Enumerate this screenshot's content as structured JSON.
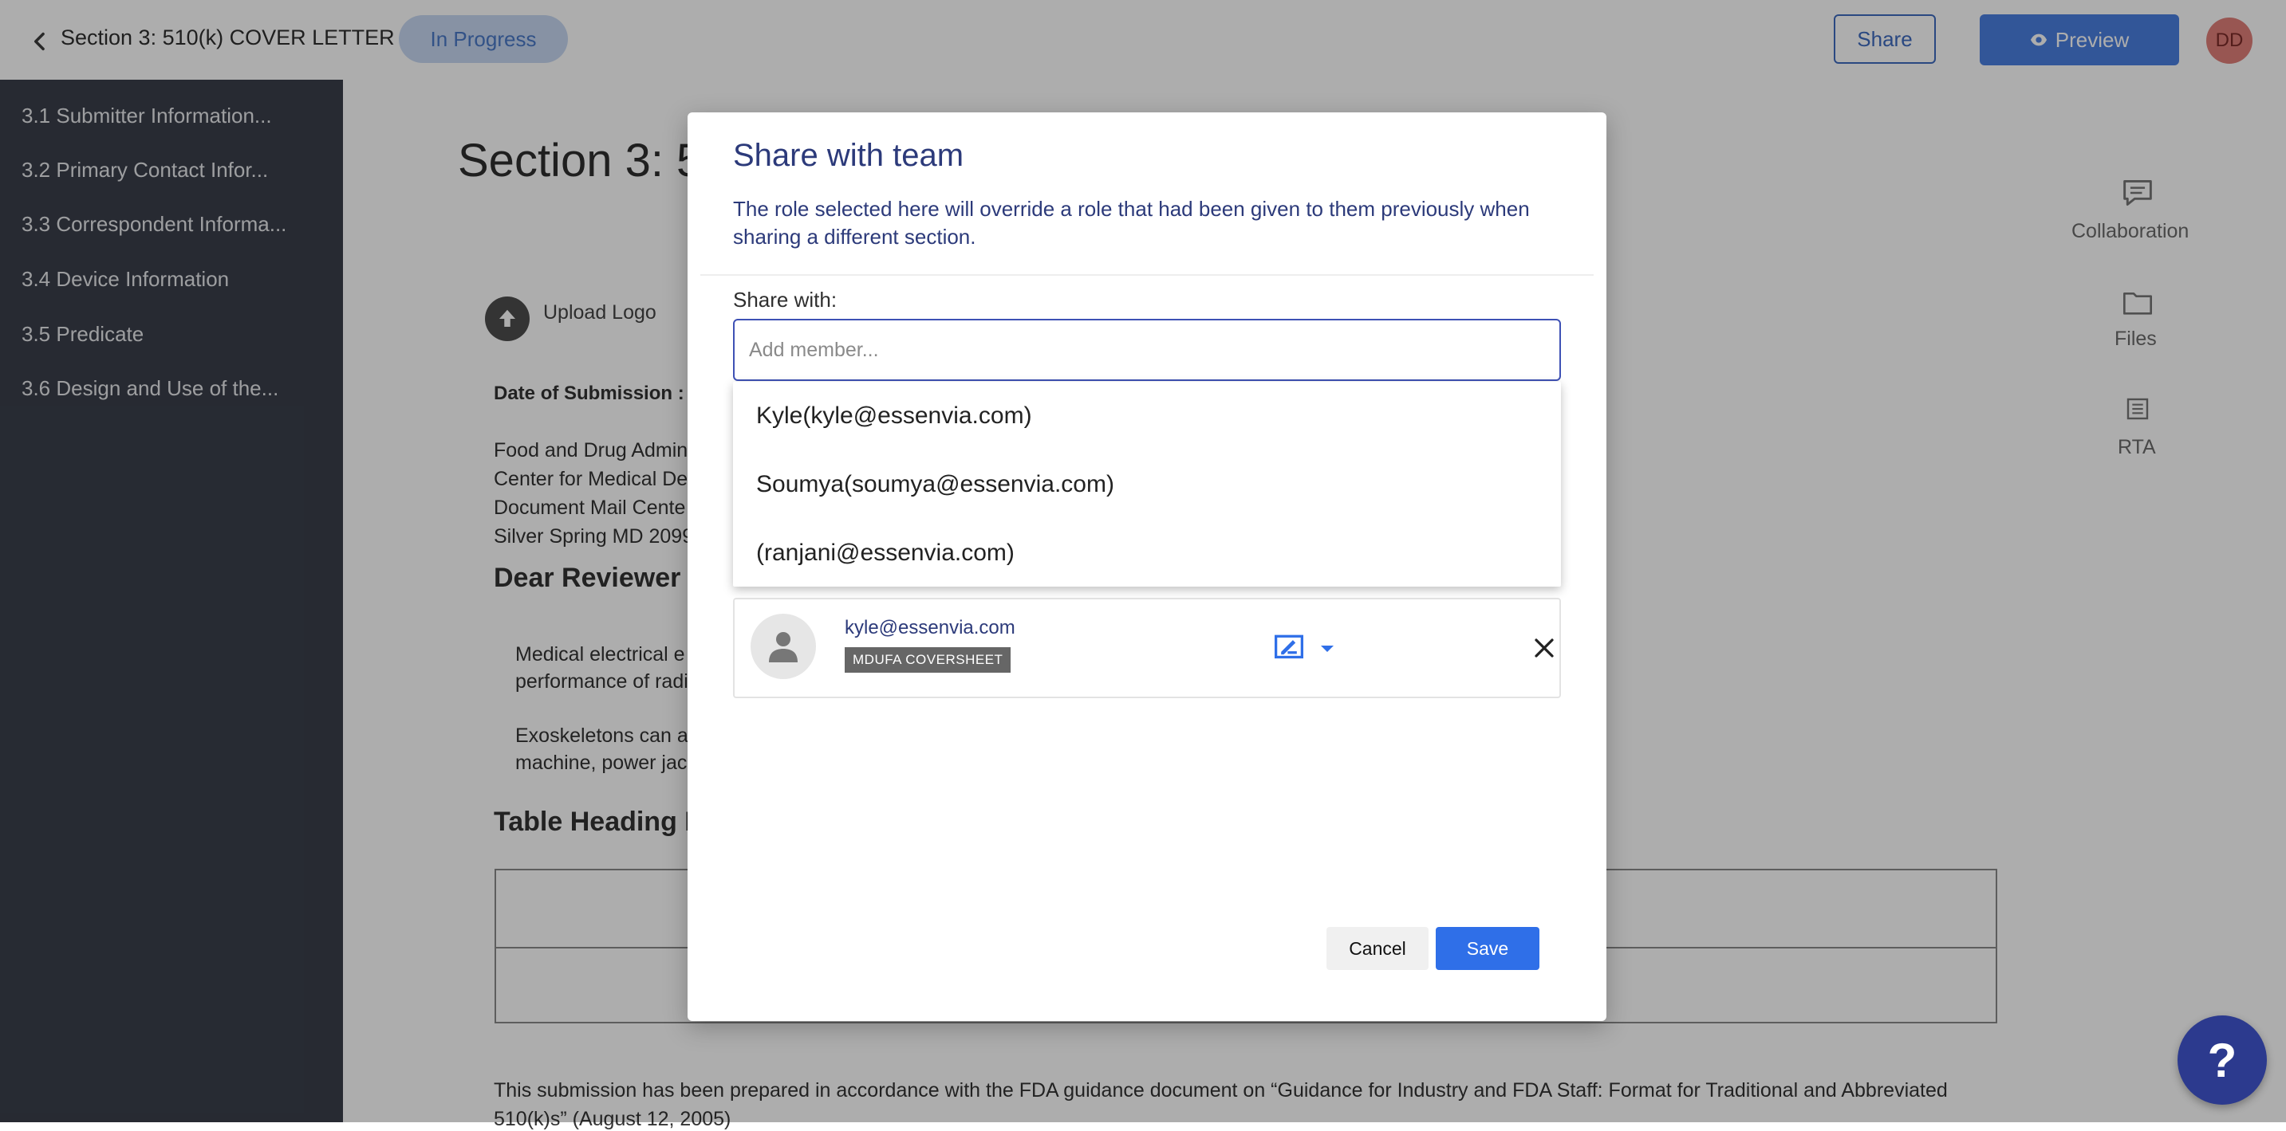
{
  "topbar": {
    "title": "Section 3:  510(k) COVER LETTER",
    "status": "In Progress",
    "share_label": "Share",
    "preview_label": "Preview",
    "avatar_initials": "DD"
  },
  "sidebar": {
    "items": [
      {
        "label": "3.1 Submitter Information..."
      },
      {
        "label": "3.2 Primary Contact Infor..."
      },
      {
        "label": "3.3 Correspondent Informa..."
      },
      {
        "label": "3.4 Device Information"
      },
      {
        "label": "3.5 Predicate"
      },
      {
        "label": "3.6 Design and Use of the..."
      }
    ]
  },
  "document": {
    "heading": "Section 3: 5",
    "upload_logo": "Upload Logo",
    "date_label": "Date of Submission :",
    "address_lines": [
      "Food and Drug Admin",
      "Center for Medical De",
      "Document Mail Cente",
      "Silver Spring MD 2099"
    ],
    "salutation": "Dear Reviewer",
    "paragraphs": [
      [
        "Medical electrical e",
        "performance of radi"
      ],
      [
        "Exoskeletons can a",
        "machine, power jac"
      ]
    ],
    "table_heading": "Table Heading H",
    "footer_lines": [
      "This submission has been prepared in accordance with the FDA guidance document on “Guidance for Industry and FDA Staff: Format for Traditional and Abbreviated",
      "510(k)s” (August 12, 2005)"
    ]
  },
  "right_rail": {
    "collaboration": "Collaboration",
    "files": "Files",
    "rta": "RTA"
  },
  "modal": {
    "title": "Share with team",
    "description": "The role selected here will override a role that had been given to them previously when sharing a different section.",
    "share_with_label": "Share with:",
    "input_placeholder": "Add member...",
    "dropdown_options": [
      {
        "label": "Kyle(kyle@essenvia.com)"
      },
      {
        "label": "Soumya(soumya@essenvia.com)"
      },
      {
        "label": "(ranjani@essenvia.com)"
      }
    ],
    "member": {
      "email": "kyle@essenvia.com",
      "badge": "MDUFA COVERSHEET"
    },
    "cancel_label": "Cancel",
    "save_label": "Save"
  },
  "help": {
    "label": "?"
  },
  "colors": {
    "sidebar_bg": "#3a3f4b",
    "accent": "#2f6fe8",
    "modal_title": "#2c3a7a",
    "help_bg": "#2c3a8e"
  }
}
